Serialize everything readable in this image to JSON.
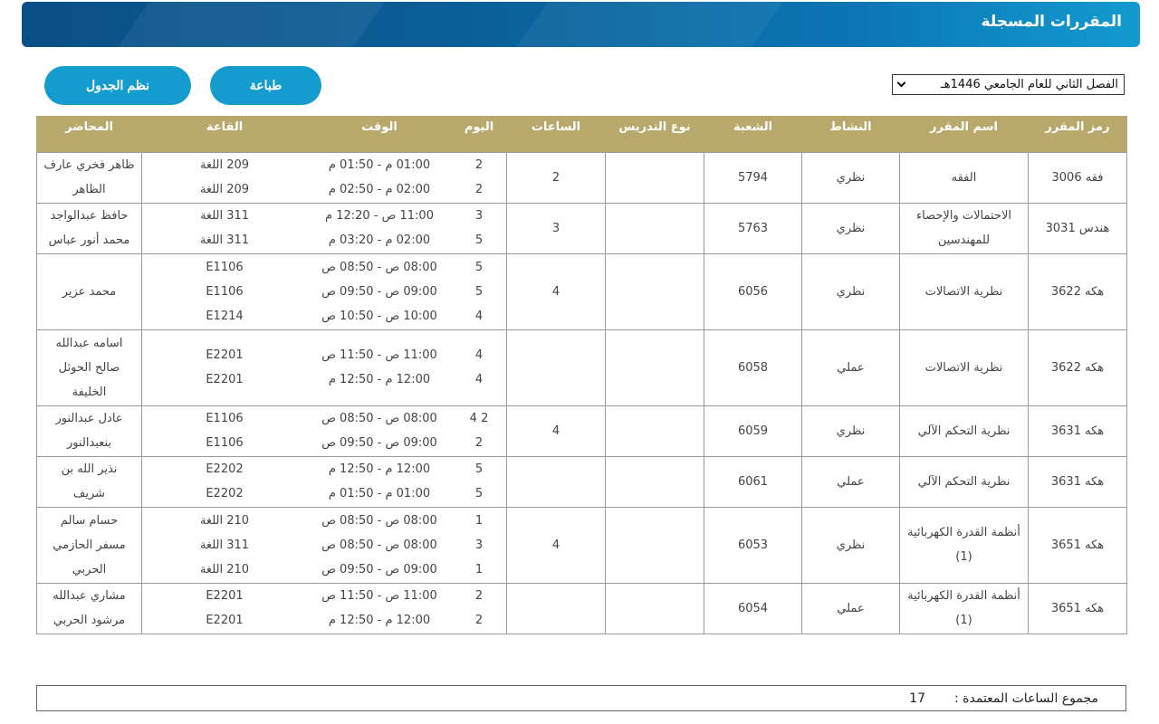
{
  "header": {
    "title": "المقررات المسجلة"
  },
  "toolbar": {
    "schedule_label": "نظم الجدول",
    "print_label": "طباعة"
  },
  "term": {
    "selected": "الفصل الثاني للعام الجامعي 1446هـ"
  },
  "table": {
    "headers": {
      "code": "رمز المقرر",
      "name": "اسم المقرر",
      "activity": "النشاط",
      "section": "الشعبة",
      "teaching": "نوع التدريس",
      "hours": "الساعات",
      "day": "اليوم",
      "time": "الوقت",
      "room": "القاعة",
      "lecturer": "المحاضر"
    },
    "rows": [
      {
        "code": "فقه 3006",
        "name": "الفقه",
        "activity": "نظري",
        "section": "5794",
        "teaching": "",
        "hours": "2",
        "sessions": [
          {
            "day": "2",
            "time": "01:00 م - 01:50 م",
            "room": "209 اللغة"
          },
          {
            "day": "2",
            "time": "02:00 م - 02:50 م",
            "room": "209 اللغة"
          }
        ],
        "lecturer": [
          "ظاهر فخري عارف",
          "الظاهر"
        ]
      },
      {
        "code": "هندس 3031",
        "name": "الاحتمالات والإحصاء للمهندسين",
        "activity": "نظري",
        "section": "5763",
        "teaching": "",
        "hours": "3",
        "sessions": [
          {
            "day": "3",
            "time": "11:00 ص - 12:20 م",
            "room": "311 اللغة"
          },
          {
            "day": "5",
            "time": "02:00 م - 03:20 م",
            "room": "311 اللغة"
          }
        ],
        "lecturer": [
          "حافظ عبدالواجد",
          "محمد أنور عباس"
        ]
      },
      {
        "code": "هكه 3622",
        "name": "نظرية الاتصالات",
        "activity": "نظري",
        "section": "6056",
        "teaching": "",
        "hours": "4",
        "sessions": [
          {
            "day": "5",
            "time": "08:00 ص - 08:50 ص",
            "room": "E1106"
          },
          {
            "day": "5",
            "time": "09:00 ص - 09:50 ص",
            "room": "E1106"
          },
          {
            "day": "4",
            "time": "10:00 ص - 10:50 ص",
            "room": "E1214"
          }
        ],
        "lecturer": [
          "محمد عزير"
        ]
      },
      {
        "code": "هكه 3622",
        "name": "نظرية الاتصالات",
        "activity": "عملي",
        "section": "6058",
        "teaching": "",
        "hours": "",
        "sessions": [
          {
            "day": "4",
            "time": "11:00 ص - 11:50 ص",
            "room": "E2201"
          },
          {
            "day": "4",
            "time": "12:00 م - 12:50 م",
            "room": "E2201"
          }
        ],
        "lecturer": [
          "اسامه عبدالله",
          "صالح الحوثل",
          "الخليفة"
        ]
      },
      {
        "code": "هكه 3631",
        "name": "نظرية التحكم الآلي",
        "activity": "نظري",
        "section": "6059",
        "teaching": "",
        "hours": "4",
        "sessions": [
          {
            "day": "2 4",
            "time": "08:00 ص - 08:50 ص",
            "room": "E1106"
          },
          {
            "day": "2",
            "time": "09:00 ص - 09:50 ص",
            "room": "E1106"
          }
        ],
        "lecturer": [
          "عادل عبدالنور",
          "بنعبدالنور"
        ]
      },
      {
        "code": "هكه 3631",
        "name": "نظرية التحكم الآلي",
        "activity": "عملي",
        "section": "6061",
        "teaching": "",
        "hours": "",
        "sessions": [
          {
            "day": "5",
            "time": "12:00 م - 12:50 م",
            "room": "E2202"
          },
          {
            "day": "5",
            "time": "01:00 م - 01:50 م",
            "room": "E2202"
          }
        ],
        "lecturer": [
          "نذير الله بن",
          "شريف"
        ]
      },
      {
        "code": "هكه 3651",
        "name": "أنظمة القدرة الكهربائية (1)",
        "activity": "نظري",
        "section": "6053",
        "teaching": "",
        "hours": "4",
        "sessions": [
          {
            "day": "1",
            "time": "08:00 ص - 08:50 ص",
            "room": "210 اللغة"
          },
          {
            "day": "3",
            "time": "08:00 ص - 08:50 ص",
            "room": "311 اللغة"
          },
          {
            "day": "1",
            "time": "09:00 ص - 09:50 ص",
            "room": "210 اللغة"
          }
        ],
        "lecturer": [
          "حسام سالم",
          "مسفر الحازمي",
          "الحربي"
        ]
      },
      {
        "code": "هكه 3651",
        "name": "أنظمة القدرة الكهربائية (1)",
        "activity": "عملي",
        "section": "6054",
        "teaching": "",
        "hours": "",
        "sessions": [
          {
            "day": "2",
            "time": "11:00 ص - 11:50 ص",
            "room": "E2201"
          },
          {
            "day": "2",
            "time": "12:00 م - 12:50 م",
            "room": "E2201"
          }
        ],
        "lecturer": [
          "مشاري عبدالله",
          "مرشود الحربي"
        ]
      }
    ]
  },
  "totals": {
    "label": "مجموع الساعات المعتمدة :",
    "value": "17"
  }
}
